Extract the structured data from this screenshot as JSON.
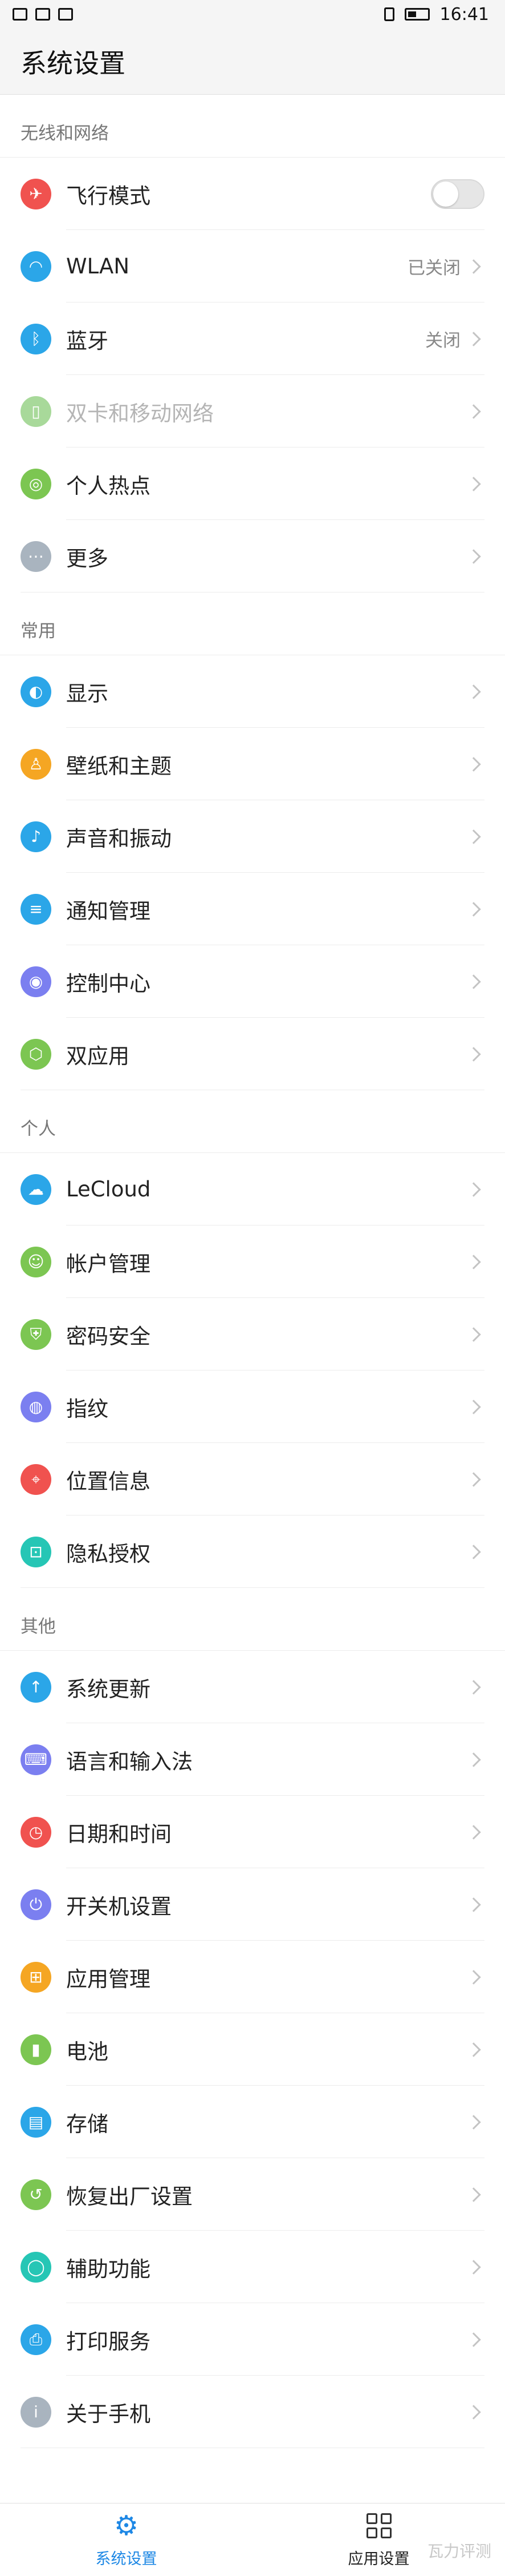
{
  "status_bar": {
    "time": "16:41"
  },
  "app_bar": {
    "title": "系统设置"
  },
  "sections": [
    {
      "header": "无线和网络",
      "items": [
        {
          "label": "飞行模式",
          "icon": "airplane-icon",
          "color": "#f0524f",
          "control": "toggle",
          "toggle_on": false
        },
        {
          "label": "WLAN",
          "icon": "wifi-icon",
          "color": "#2ba6e8",
          "value": "已关闭"
        },
        {
          "label": "蓝牙",
          "icon": "bluetooth-icon",
          "color": "#2ba6e8",
          "value": "关闭"
        },
        {
          "label": "双卡和移动网络",
          "icon": "sim-icon",
          "color": "#a8d99a",
          "disabled": true
        },
        {
          "label": "个人热点",
          "icon": "hotspot-icon",
          "color": "#7cc652"
        },
        {
          "label": "更多",
          "icon": "more-icon",
          "color": "#a9b4bf"
        }
      ]
    },
    {
      "header": "常用",
      "items": [
        {
          "label": "显示",
          "icon": "display-icon",
          "color": "#2ba6e8"
        },
        {
          "label": "壁纸和主题",
          "icon": "theme-icon",
          "color": "#f5a623"
        },
        {
          "label": "声音和振动",
          "icon": "sound-icon",
          "color": "#2ba6e8"
        },
        {
          "label": "通知管理",
          "icon": "notification-icon",
          "color": "#2ba6e8"
        },
        {
          "label": "控制中心",
          "icon": "control-center-icon",
          "color": "#7b7ff0"
        },
        {
          "label": "双应用",
          "icon": "dual-app-icon",
          "color": "#7cc652"
        }
      ]
    },
    {
      "header": "个人",
      "items": [
        {
          "label": "LeCloud",
          "icon": "cloud-icon",
          "color": "#2ba6e8"
        },
        {
          "label": "帐户管理",
          "icon": "account-icon",
          "color": "#7cc652"
        },
        {
          "label": "密码安全",
          "icon": "shield-icon",
          "color": "#7cc652"
        },
        {
          "label": "指纹",
          "icon": "fingerprint-icon",
          "color": "#7b7ff0"
        },
        {
          "label": "位置信息",
          "icon": "location-icon",
          "color": "#f0524f"
        },
        {
          "label": "隐私授权",
          "icon": "lock-icon",
          "color": "#26c6b5"
        }
      ]
    },
    {
      "header": "其他",
      "items": [
        {
          "label": "系统更新",
          "icon": "update-icon",
          "color": "#2ba6e8"
        },
        {
          "label": "语言和输入法",
          "icon": "keyboard-icon",
          "color": "#7b7ff0"
        },
        {
          "label": "日期和时间",
          "icon": "clock-icon",
          "color": "#f0524f"
        },
        {
          "label": "开关机设置",
          "icon": "power-icon",
          "color": "#7b7ff0"
        },
        {
          "label": "应用管理",
          "icon": "apps-icon",
          "color": "#f5a623"
        },
        {
          "label": "电池",
          "icon": "battery-icon",
          "color": "#7cc652"
        },
        {
          "label": "存储",
          "icon": "storage-icon",
          "color": "#2ba6e8"
        },
        {
          "label": "恢复出厂设置",
          "icon": "reset-icon",
          "color": "#7cc652"
        },
        {
          "label": "辅助功能",
          "icon": "accessibility-icon",
          "color": "#26c6b5"
        },
        {
          "label": "打印服务",
          "icon": "print-icon",
          "color": "#2ba6e8"
        },
        {
          "label": "关于手机",
          "icon": "info-icon",
          "color": "#a9b4bf"
        }
      ]
    }
  ],
  "bottom_nav": [
    {
      "label": "系统设置",
      "icon": "gear-icon",
      "active": true
    },
    {
      "label": "应用设置",
      "icon": "grid-icon",
      "active": false
    }
  ],
  "watermark": "瓦力评测"
}
